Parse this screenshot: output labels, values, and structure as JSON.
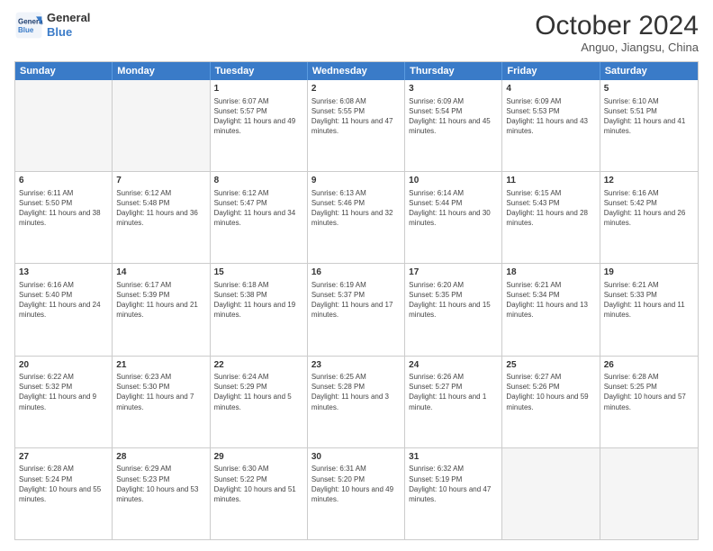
{
  "header": {
    "logo_line1": "General",
    "logo_line2": "Blue",
    "month_title": "October 2024",
    "location": "Anguo, Jiangsu, China"
  },
  "weekdays": [
    "Sunday",
    "Monday",
    "Tuesday",
    "Wednesday",
    "Thursday",
    "Friday",
    "Saturday"
  ],
  "weeks": [
    [
      {
        "day": "",
        "sunrise": "",
        "sunset": "",
        "daylight": ""
      },
      {
        "day": "",
        "sunrise": "",
        "sunset": "",
        "daylight": ""
      },
      {
        "day": "1",
        "sunrise": "Sunrise: 6:07 AM",
        "sunset": "Sunset: 5:57 PM",
        "daylight": "Daylight: 11 hours and 49 minutes."
      },
      {
        "day": "2",
        "sunrise": "Sunrise: 6:08 AM",
        "sunset": "Sunset: 5:55 PM",
        "daylight": "Daylight: 11 hours and 47 minutes."
      },
      {
        "day": "3",
        "sunrise": "Sunrise: 6:09 AM",
        "sunset": "Sunset: 5:54 PM",
        "daylight": "Daylight: 11 hours and 45 minutes."
      },
      {
        "day": "4",
        "sunrise": "Sunrise: 6:09 AM",
        "sunset": "Sunset: 5:53 PM",
        "daylight": "Daylight: 11 hours and 43 minutes."
      },
      {
        "day": "5",
        "sunrise": "Sunrise: 6:10 AM",
        "sunset": "Sunset: 5:51 PM",
        "daylight": "Daylight: 11 hours and 41 minutes."
      }
    ],
    [
      {
        "day": "6",
        "sunrise": "Sunrise: 6:11 AM",
        "sunset": "Sunset: 5:50 PM",
        "daylight": "Daylight: 11 hours and 38 minutes."
      },
      {
        "day": "7",
        "sunrise": "Sunrise: 6:12 AM",
        "sunset": "Sunset: 5:48 PM",
        "daylight": "Daylight: 11 hours and 36 minutes."
      },
      {
        "day": "8",
        "sunrise": "Sunrise: 6:12 AM",
        "sunset": "Sunset: 5:47 PM",
        "daylight": "Daylight: 11 hours and 34 minutes."
      },
      {
        "day": "9",
        "sunrise": "Sunrise: 6:13 AM",
        "sunset": "Sunset: 5:46 PM",
        "daylight": "Daylight: 11 hours and 32 minutes."
      },
      {
        "day": "10",
        "sunrise": "Sunrise: 6:14 AM",
        "sunset": "Sunset: 5:44 PM",
        "daylight": "Daylight: 11 hours and 30 minutes."
      },
      {
        "day": "11",
        "sunrise": "Sunrise: 6:15 AM",
        "sunset": "Sunset: 5:43 PM",
        "daylight": "Daylight: 11 hours and 28 minutes."
      },
      {
        "day": "12",
        "sunrise": "Sunrise: 6:16 AM",
        "sunset": "Sunset: 5:42 PM",
        "daylight": "Daylight: 11 hours and 26 minutes."
      }
    ],
    [
      {
        "day": "13",
        "sunrise": "Sunrise: 6:16 AM",
        "sunset": "Sunset: 5:40 PM",
        "daylight": "Daylight: 11 hours and 24 minutes."
      },
      {
        "day": "14",
        "sunrise": "Sunrise: 6:17 AM",
        "sunset": "Sunset: 5:39 PM",
        "daylight": "Daylight: 11 hours and 21 minutes."
      },
      {
        "day": "15",
        "sunrise": "Sunrise: 6:18 AM",
        "sunset": "Sunset: 5:38 PM",
        "daylight": "Daylight: 11 hours and 19 minutes."
      },
      {
        "day": "16",
        "sunrise": "Sunrise: 6:19 AM",
        "sunset": "Sunset: 5:37 PM",
        "daylight": "Daylight: 11 hours and 17 minutes."
      },
      {
        "day": "17",
        "sunrise": "Sunrise: 6:20 AM",
        "sunset": "Sunset: 5:35 PM",
        "daylight": "Daylight: 11 hours and 15 minutes."
      },
      {
        "day": "18",
        "sunrise": "Sunrise: 6:21 AM",
        "sunset": "Sunset: 5:34 PM",
        "daylight": "Daylight: 11 hours and 13 minutes."
      },
      {
        "day": "19",
        "sunrise": "Sunrise: 6:21 AM",
        "sunset": "Sunset: 5:33 PM",
        "daylight": "Daylight: 11 hours and 11 minutes."
      }
    ],
    [
      {
        "day": "20",
        "sunrise": "Sunrise: 6:22 AM",
        "sunset": "Sunset: 5:32 PM",
        "daylight": "Daylight: 11 hours and 9 minutes."
      },
      {
        "day": "21",
        "sunrise": "Sunrise: 6:23 AM",
        "sunset": "Sunset: 5:30 PM",
        "daylight": "Daylight: 11 hours and 7 minutes."
      },
      {
        "day": "22",
        "sunrise": "Sunrise: 6:24 AM",
        "sunset": "Sunset: 5:29 PM",
        "daylight": "Daylight: 11 hours and 5 minutes."
      },
      {
        "day": "23",
        "sunrise": "Sunrise: 6:25 AM",
        "sunset": "Sunset: 5:28 PM",
        "daylight": "Daylight: 11 hours and 3 minutes."
      },
      {
        "day": "24",
        "sunrise": "Sunrise: 6:26 AM",
        "sunset": "Sunset: 5:27 PM",
        "daylight": "Daylight: 11 hours and 1 minute."
      },
      {
        "day": "25",
        "sunrise": "Sunrise: 6:27 AM",
        "sunset": "Sunset: 5:26 PM",
        "daylight": "Daylight: 10 hours and 59 minutes."
      },
      {
        "day": "26",
        "sunrise": "Sunrise: 6:28 AM",
        "sunset": "Sunset: 5:25 PM",
        "daylight": "Daylight: 10 hours and 57 minutes."
      }
    ],
    [
      {
        "day": "27",
        "sunrise": "Sunrise: 6:28 AM",
        "sunset": "Sunset: 5:24 PM",
        "daylight": "Daylight: 10 hours and 55 minutes."
      },
      {
        "day": "28",
        "sunrise": "Sunrise: 6:29 AM",
        "sunset": "Sunset: 5:23 PM",
        "daylight": "Daylight: 10 hours and 53 minutes."
      },
      {
        "day": "29",
        "sunrise": "Sunrise: 6:30 AM",
        "sunset": "Sunset: 5:22 PM",
        "daylight": "Daylight: 10 hours and 51 minutes."
      },
      {
        "day": "30",
        "sunrise": "Sunrise: 6:31 AM",
        "sunset": "Sunset: 5:20 PM",
        "daylight": "Daylight: 10 hours and 49 minutes."
      },
      {
        "day": "31",
        "sunrise": "Sunrise: 6:32 AM",
        "sunset": "Sunset: 5:19 PM",
        "daylight": "Daylight: 10 hours and 47 minutes."
      },
      {
        "day": "",
        "sunrise": "",
        "sunset": "",
        "daylight": ""
      },
      {
        "day": "",
        "sunrise": "",
        "sunset": "",
        "daylight": ""
      }
    ]
  ]
}
